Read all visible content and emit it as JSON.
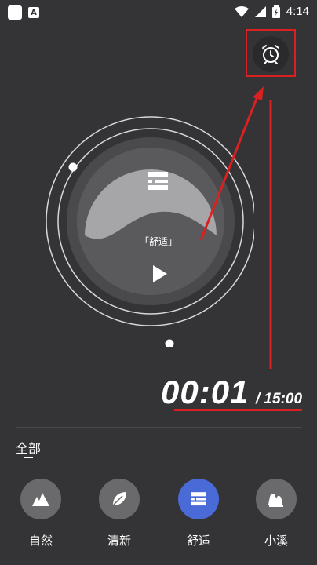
{
  "status_bar": {
    "time": "4:14",
    "icons": [
      "app-square-icon",
      "a-icon",
      "wifi-icon",
      "signal-icon",
      "battery-icon"
    ]
  },
  "player": {
    "disc_label": "「舒适」",
    "playlist_icon": "playlist-icon",
    "play_icon": "play-icon"
  },
  "timer": {
    "current": "00:01",
    "total": "/ 15:00"
  },
  "category_tab": {
    "label": "全部"
  },
  "categories": [
    {
      "label": "自然",
      "icon": "mountain-icon",
      "active": false
    },
    {
      "label": "清新",
      "icon": "leaf-icon",
      "active": false
    },
    {
      "label": "舒适",
      "icon": "playlist-icon",
      "active": true
    },
    {
      "label": "小溪",
      "icon": "stream-icon",
      "active": false
    }
  ],
  "colors": {
    "background": "#343436",
    "accent": "#4a6ad8",
    "annotation": "#d92121"
  }
}
